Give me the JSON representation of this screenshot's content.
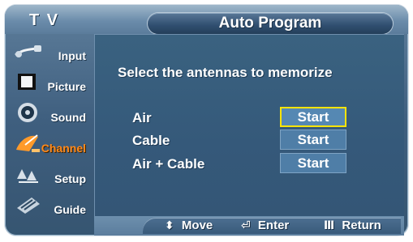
{
  "header": {
    "tv_label": "T V",
    "title": "Auto Program"
  },
  "sidebar": {
    "items": [
      {
        "label": "Input",
        "icon": "input-cable-icon",
        "active": false
      },
      {
        "label": "Picture",
        "icon": "picture-icon",
        "active": false
      },
      {
        "label": "Sound",
        "icon": "speaker-icon",
        "active": false
      },
      {
        "label": "Channel",
        "icon": "satellite-dish-icon",
        "active": true
      },
      {
        "label": "Setup",
        "icon": "setup-icon",
        "active": false
      },
      {
        "label": "Guide",
        "icon": "guide-icon",
        "active": false
      }
    ]
  },
  "main": {
    "heading": "Select the antennas to memorize",
    "options": [
      {
        "label": "Air",
        "button": "Start",
        "selected": true
      },
      {
        "label": "Cable",
        "button": "Start",
        "selected": false
      },
      {
        "label": "Air + Cable",
        "button": "Start",
        "selected": false
      }
    ]
  },
  "footer": {
    "move": {
      "glyph": "⬍",
      "label": "Move"
    },
    "enter": {
      "glyph": "⏎",
      "label": "Enter"
    },
    "return": {
      "glyph": "Ⅲ",
      "label": "Return"
    }
  },
  "colors": {
    "accent_selected": "#ffe400",
    "active_menu": "#ff8a1c",
    "panel": "#35597a"
  }
}
